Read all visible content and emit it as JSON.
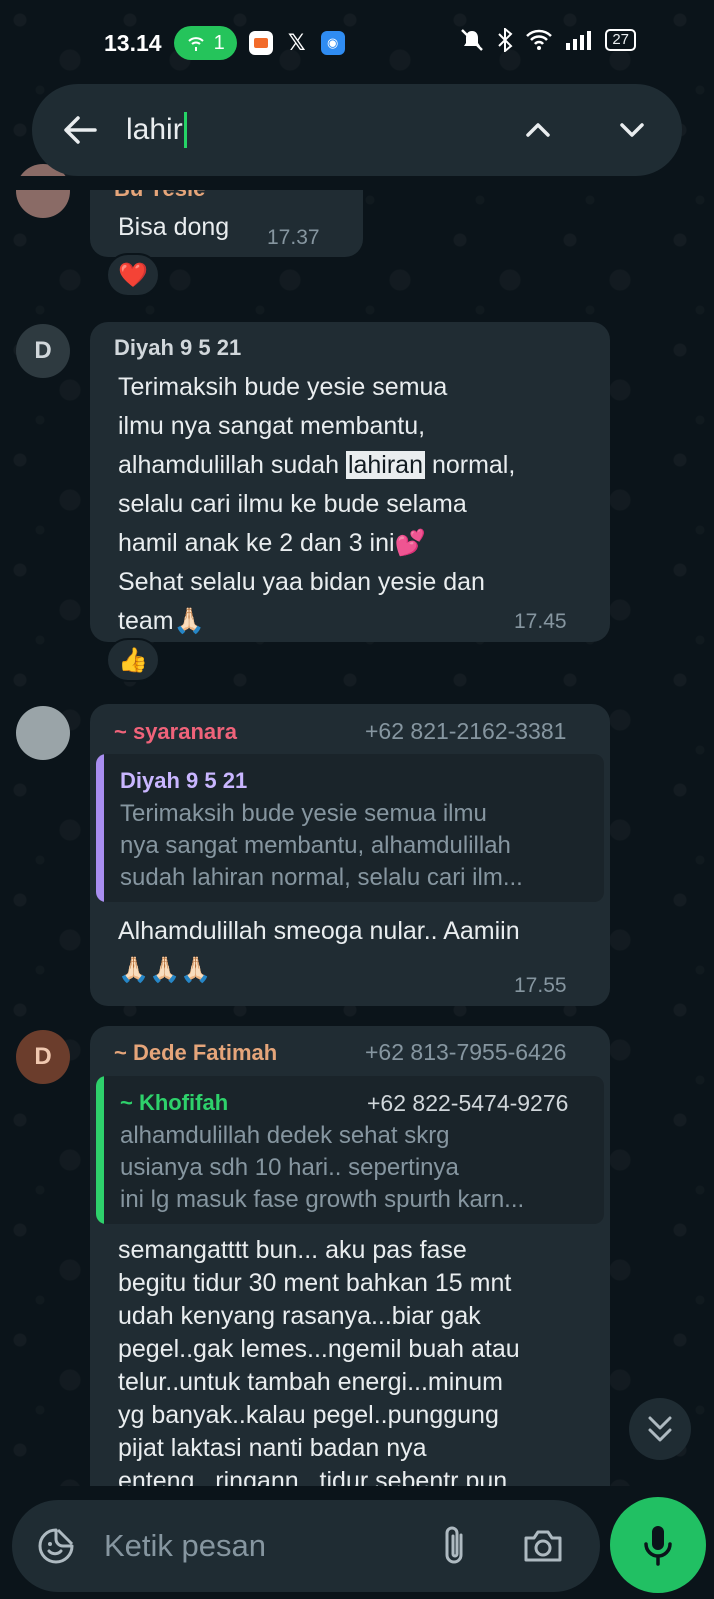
{
  "status_bar": {
    "time": "13.14",
    "hotspot_count": "1",
    "battery": "27",
    "apps": [
      {
        "name": "photo-app-icon",
        "color": "#f26b2a"
      },
      {
        "name": "x-icon",
        "glyph": "X"
      },
      {
        "name": "discord-icon",
        "color": "#2f8cf2"
      }
    ]
  },
  "search": {
    "query": "lahir"
  },
  "messages": [
    {
      "sender": "Bu Yesie",
      "text": "Bisa dong",
      "time": "17.37",
      "reaction": "❤️"
    },
    {
      "avatar_letter": "D",
      "sender": "Diyah 9 5 21",
      "lines": [
        "Terimaksih bude yesie semua",
        "ilmu nya sangat membantu,",
        "alhamdulillah sudah ",
        "lahiran",
        " normal,",
        "selalu cari ilmu ke bude selama",
        "hamil anak ke 2 dan 3 ini💕",
        "Sehat selalu yaa bidan yesie dan",
        "team🙏🏻"
      ],
      "time": "17.45",
      "reaction": "👍"
    },
    {
      "sender": "~ syaranara",
      "phone": "+62 821-2162-3381",
      "quote": {
        "name": "Diyah 9 5 21",
        "lines": [
          "Terimaksih bude yesie semua ilmu",
          "nya sangat membantu, alhamdulillah",
          "sudah lahiran normal, selalu cari ilm..."
        ]
      },
      "lines": [
        "Alhamdulillah smeoga nular.. Aamiin",
        "🙏🏻🙏🏻🙏🏻"
      ],
      "time": "17.55"
    },
    {
      "avatar_letter": "D",
      "sender": "~ Dede Fatimah",
      "phone": "+62 813-7955-6426",
      "quote": {
        "name": "~ Khofifah",
        "phone": "+62 822-5474-9276",
        "lines": [
          "alhamdulillah dedek sehat skrg",
          "usianya sdh 10 hari.. sepertinya",
          "ini lg masuk fase growth spurth karn..."
        ]
      },
      "lines": [
        "semangatttt bun... aku pas fase",
        "begitu tidur 30 ment bahkan 15 mnt",
        "udah kenyang rasanya...biar gak",
        "pegel..gak lemes...ngemil  buah atau",
        "telur..untuk tambah energi...minum",
        "yg banyak..kalau pegel..punggung",
        "pijat laktasi nanti badan nya",
        "enteng...ringann...tidur sebentr pun"
      ]
    }
  ],
  "composer": {
    "placeholder": "Ketik pesan"
  },
  "colors": {
    "accent_green": "#25d366",
    "syaranara": "#f0637a",
    "dede": "#e5a57a",
    "khofifah": "#2ed16b",
    "quote_diyah": "#a98ef0"
  }
}
